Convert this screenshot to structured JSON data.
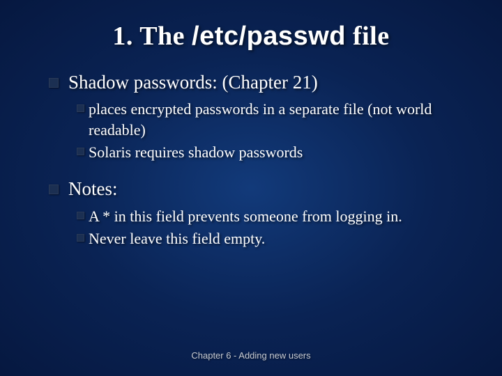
{
  "title": {
    "part1": "1. The ",
    "code": "/etc/passwd",
    "part2": " file"
  },
  "items": [
    {
      "text": "Shadow passwords: (Chapter 21)",
      "sub": [
        "places encrypted passwords in a separate file (not world readable)",
        "Solaris requires shadow passwords"
      ]
    },
    {
      "text": "Notes:",
      "sub": [
        "A * in this field prevents someone from logging in.",
        "Never leave this field empty."
      ]
    }
  ],
  "footer": "Chapter 6 - Adding new users"
}
